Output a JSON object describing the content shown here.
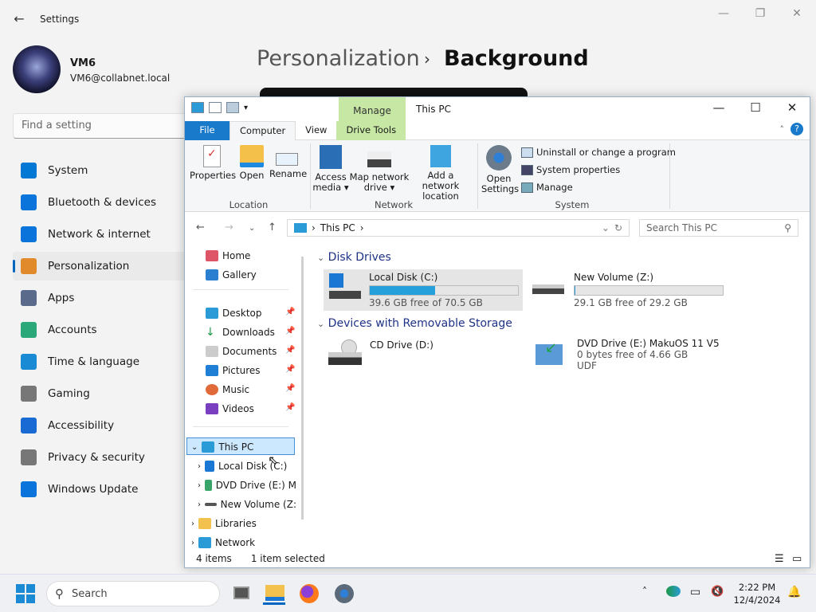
{
  "settings": {
    "title": "Settings",
    "user": {
      "name": "VM6",
      "email": "VM6@collabnet.local"
    },
    "search_placeholder": "Find a setting",
    "breadcrumb": {
      "parent": "Personalization",
      "current": "Background"
    },
    "nav": [
      {
        "label": "System",
        "icon": "system-icon",
        "color": "#0078d4"
      },
      {
        "label": "Bluetooth & devices",
        "icon": "bluetooth-icon",
        "color": "#0a74da"
      },
      {
        "label": "Network & internet",
        "icon": "wifi-icon",
        "color": "#0a74da"
      },
      {
        "label": "Personalization",
        "icon": "brush-icon",
        "color": "#e08a2c",
        "selected": true
      },
      {
        "label": "Apps",
        "icon": "apps-icon",
        "color": "#5a6a8a"
      },
      {
        "label": "Accounts",
        "icon": "accounts-icon",
        "color": "#2aa87a"
      },
      {
        "label": "Time & language",
        "icon": "clock-icon",
        "color": "#1a8ad4"
      },
      {
        "label": "Gaming",
        "icon": "gamepad-icon",
        "color": "#777"
      },
      {
        "label": "Accessibility",
        "icon": "accessibility-icon",
        "color": "#1a6ad4"
      },
      {
        "label": "Privacy & security",
        "icon": "shield-icon",
        "color": "#777"
      },
      {
        "label": "Windows Update",
        "icon": "update-icon",
        "color": "#0a74da"
      }
    ]
  },
  "explorer": {
    "title": "This PC",
    "manage_tab": "Manage",
    "tabs": {
      "file": "File",
      "computer": "Computer",
      "view": "View",
      "drive_tools": "Drive Tools"
    },
    "ribbon": {
      "properties": "Properties",
      "open": "Open",
      "rename": "Rename",
      "location": "Location",
      "access_media": "Access media",
      "map_drive": "Map network drive",
      "add_location": "Add a network location",
      "network": "Network",
      "open_settings": "Open Settings",
      "uninstall": "Uninstall or change a program",
      "sys_props": "System properties",
      "manage": "Manage",
      "system": "System"
    },
    "address": {
      "path": "This PC",
      "search_placeholder": "Search This PC"
    },
    "tree": {
      "home": "Home",
      "gallery": "Gallery",
      "desktop": "Desktop",
      "downloads": "Downloads",
      "documents": "Documents",
      "pictures": "Pictures",
      "music": "Music",
      "videos": "Videos",
      "this_pc": "This PC",
      "local_disk": "Local Disk (C:)",
      "dvd": "DVD Drive (E:) M",
      "new_volume": "New Volume (Z:",
      "libraries": "Libraries",
      "network": "Network"
    },
    "sections": {
      "disk_drives": "Disk Drives",
      "removable": "Devices with Removable Storage"
    },
    "drives": {
      "c": {
        "name": "Local Disk (C:)",
        "free": "39.6 GB free of 70.5 GB",
        "used_fraction": 0.44
      },
      "z": {
        "name": "New Volume (Z:)",
        "free": "29.1 GB free of 29.2 GB",
        "used_fraction": 0.005
      },
      "d": {
        "name": "CD Drive (D:)"
      },
      "e": {
        "name": "DVD Drive (E:) MakuOS 11 V5",
        "free": "0 bytes free of 4.66 GB",
        "fs": "UDF"
      }
    },
    "status": {
      "items": "4 items",
      "selected": "1 item selected"
    }
  },
  "taskbar": {
    "search": "Search",
    "time": "2:22 PM",
    "date": "12/4/2024"
  }
}
